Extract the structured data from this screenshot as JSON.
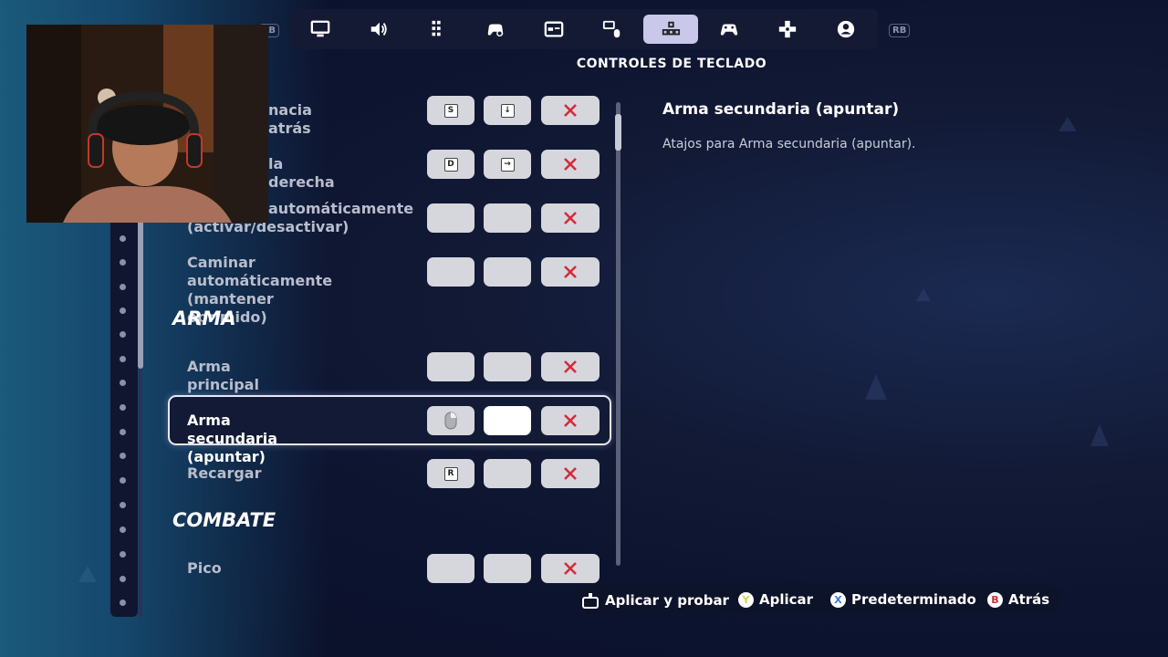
{
  "header": {
    "title": "CONTROLES DE TECLADO",
    "lb_label": "LB",
    "rb_label": "RB",
    "tabs": [
      {
        "icon": "monitor-icon"
      },
      {
        "icon": "speaker-icon"
      },
      {
        "icon": "grid-icon"
      },
      {
        "icon": "gamepad-settings-icon"
      },
      {
        "icon": "window-icon"
      },
      {
        "icon": "keyboard-mouse-icon"
      },
      {
        "icon": "keyboard-controls-icon",
        "active": true
      },
      {
        "icon": "controller-icon"
      },
      {
        "icon": "dpad-icon"
      },
      {
        "icon": "account-icon"
      }
    ]
  },
  "bindings": {
    "rows": [
      {
        "label": "Caminar hacia atrás",
        "visible_label": "nacia atrás",
        "key1": "S",
        "key2": "↓"
      },
      {
        "label": "Caminar a la derecha",
        "visible_label": "la derecha",
        "key1": "D",
        "key2": "→"
      },
      {
        "label_line1": "automáticamente",
        "label_line2": "(activar/desactivar)",
        "key1": "",
        "key2": ""
      },
      {
        "label_line1": "Caminar automáticamente",
        "label_line2": "(mantener oprimido)",
        "key1": "",
        "key2": ""
      }
    ],
    "section_arma": "ARMA",
    "arma_rows": [
      {
        "label": "Arma principal (disparar)",
        "key1": "",
        "key2": ""
      },
      {
        "label": "Arma secundaria (apuntar)",
        "key1": "mouse-right-icon",
        "key2": "",
        "selected": true
      },
      {
        "label": "Recargar",
        "key1": "R",
        "key2": ""
      }
    ],
    "section_combate": "COMBATE",
    "combate_rows": [
      {
        "label": "Pico",
        "key1": "",
        "key2": ""
      }
    ],
    "delete_icon": "close-x-icon",
    "delete_color": "#d42a3a"
  },
  "detail": {
    "title": "Arma secundaria (apuntar)",
    "description": "Atajos para Arma secundaria (apuntar)."
  },
  "footer": {
    "apply_test": "Aplicar y probar",
    "apply_button": "Y",
    "apply": "Aplicar",
    "default_button": "X",
    "default": "Predeterminado",
    "back_button": "B",
    "back": "Atrás"
  },
  "colors": {
    "accent_tab": "#c9c7ea",
    "y_button": "#c9d94a",
    "x_button": "#3a7ad8",
    "b_button": "#d42a3a"
  }
}
